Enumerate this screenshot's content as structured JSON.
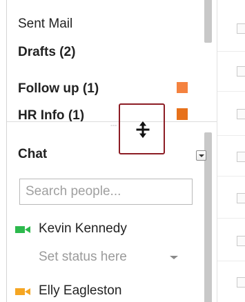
{
  "nav": {
    "items": [
      {
        "label": "Sent Mail"
      },
      {
        "label": "Drafts (2)"
      },
      {
        "label": "Follow up (1)"
      },
      {
        "label": "HR Info (1)"
      }
    ],
    "label_colors": {
      "follow_up": "#f4823f",
      "hr_info": "#e7711b"
    }
  },
  "chat": {
    "title": "Chat",
    "search_placeholder": "Search people...",
    "contacts": [
      {
        "name": "Kevin Kennedy",
        "status_icon": "video-camera-icon",
        "status_color": "#2db94d"
      },
      {
        "name": "Elly Eagleston",
        "status_icon": "video-camera-icon",
        "status_color": "#f5a623"
      }
    ],
    "self_status_prompt": "Set status here"
  },
  "cursor": {
    "icon": "resize-vertical-cursor-icon",
    "highlight_color": "#8c1c24"
  }
}
